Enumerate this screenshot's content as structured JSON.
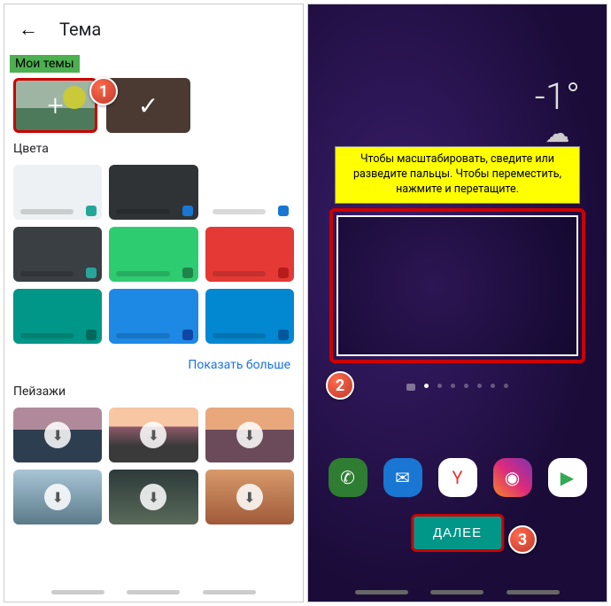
{
  "left": {
    "title": "Тема",
    "my_themes_label": "Мои темы",
    "colors_label": "Цвета",
    "show_more": "Показать больше",
    "landscapes_label": "Пейзажи",
    "color_tiles": [
      {
        "bg": "#eef1f3",
        "dot": "#26a69a"
      },
      {
        "bg": "#2f3336",
        "dot": "#1976d2"
      },
      {
        "bg": "#ffffff",
        "dot": "#1976d2"
      },
      {
        "bg": "#3a3f44",
        "dot": "#26a69a"
      },
      {
        "bg": "#2ecc71",
        "dot": "#1e8449"
      },
      {
        "bg": "#e53935",
        "dot": "#b71c1c"
      },
      {
        "bg": "#009688",
        "dot": "#00695c"
      },
      {
        "bg": "#1e88e5",
        "dot": "#0d47a1"
      },
      {
        "bg": "#0288d1",
        "dot": "#01579b"
      }
    ],
    "landscapes": [
      "linear-gradient(180deg,#b08a9a 40%,#2d3e50 40%)",
      "linear-gradient(180deg,#f7c6a3 35%,#8e5a6a 35%,#3a3a3a 70%)",
      "linear-gradient(180deg,#e8a87c 40%,#6b4a5a 40%)",
      "linear-gradient(180deg,#a8c5d6,#5a7a8a)",
      "linear-gradient(180deg,#2d3a3a,#5a6a5a)",
      "linear-gradient(180deg,#d89a6a,#a05a3a)"
    ]
  },
  "right": {
    "temperature": "-1°",
    "hint": "Чтобы масштабировать, сведите или разведите пальцы. Чтобы переместить, нажмите и перетащите.",
    "next_label": "ДАЛЕЕ",
    "dock": [
      {
        "name": "phone-icon",
        "bg": "#2e7d32",
        "glyph": "✆"
      },
      {
        "name": "messages-icon",
        "bg": "#1976d2",
        "glyph": "✉"
      },
      {
        "name": "yandex-icon",
        "bg": "#ffffff",
        "glyph": "Y",
        "color": "#e53935"
      },
      {
        "name": "instagram-icon",
        "bg": "linear-gradient(45deg,#f58529,#dd2a7b,#8134af)",
        "glyph": "◉"
      },
      {
        "name": "play-store-icon",
        "bg": "#ffffff",
        "glyph": "▶",
        "color": "#34a853"
      }
    ]
  },
  "steps": {
    "s1": "1",
    "s2": "2",
    "s3": "3"
  }
}
